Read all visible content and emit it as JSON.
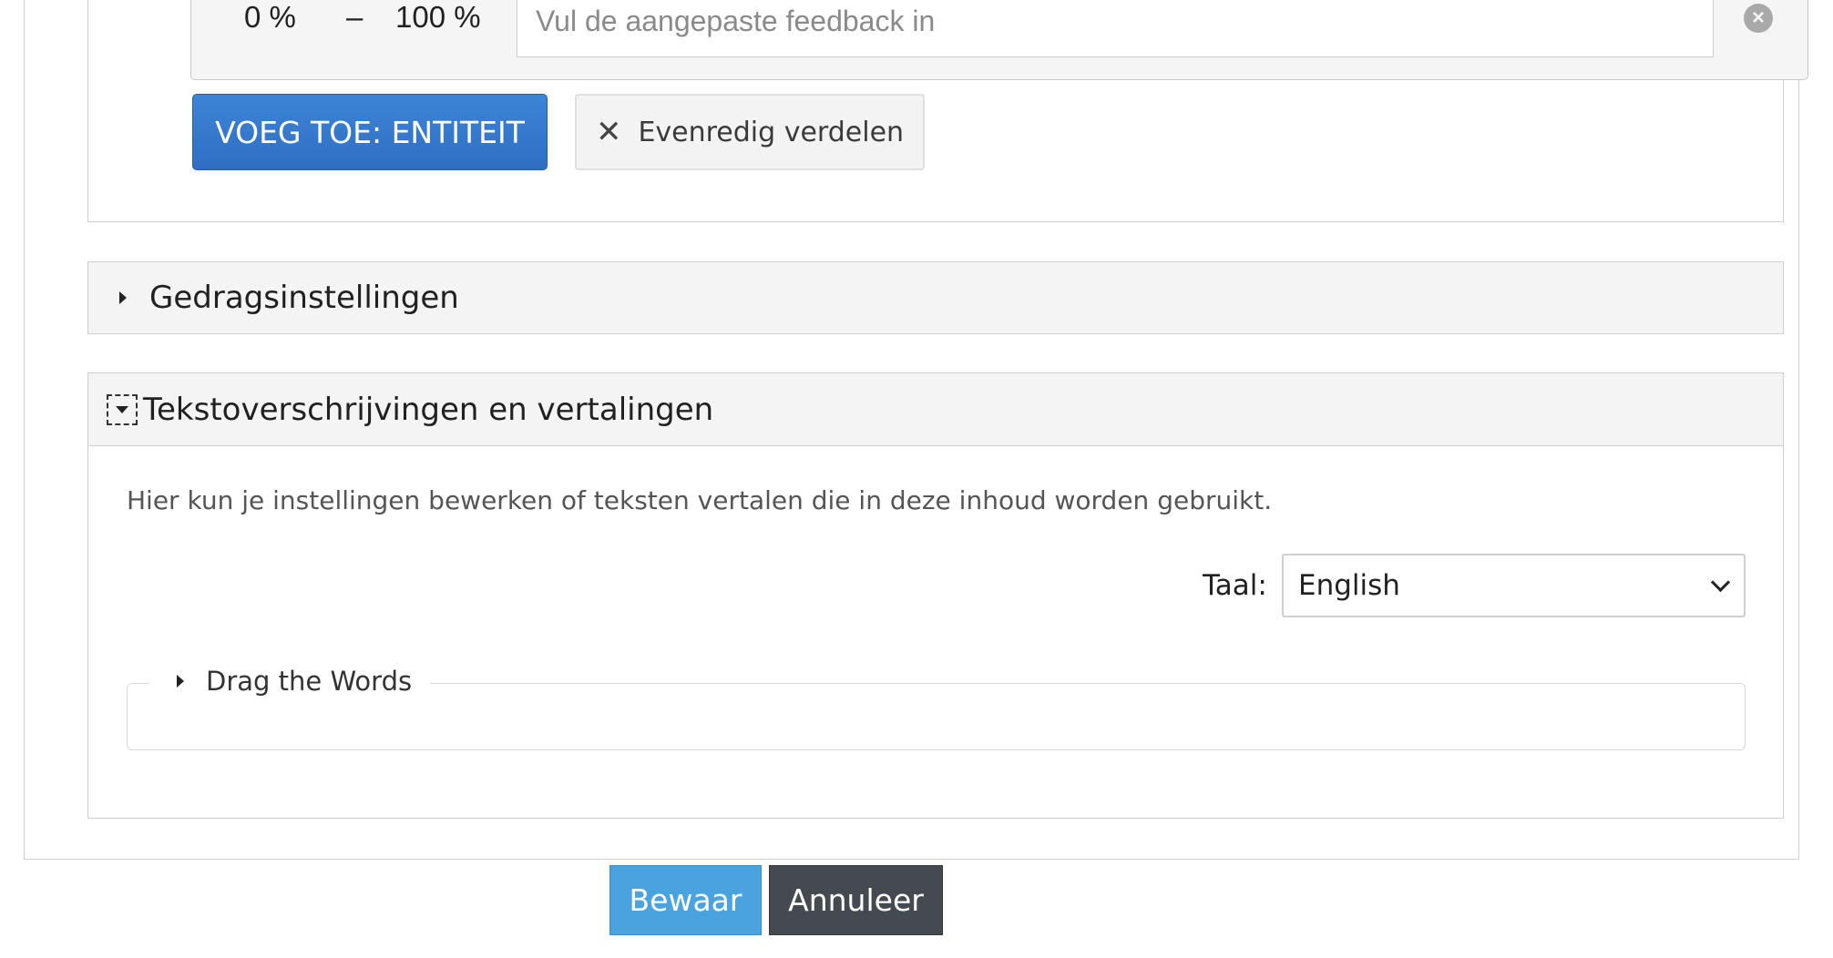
{
  "feedback_range": {
    "from": "0 %",
    "separator": "–",
    "to": "100 %",
    "input_placeholder": "Vul de aangepaste feedback in",
    "remove_icon": "×"
  },
  "buttons": {
    "add_entity": "VOEG TOE: ENTITEIT",
    "distribute_icon": "✕",
    "distribute": "Evenredig verdelen",
    "save": "Bewaar",
    "cancel": "Annuleer"
  },
  "groups": {
    "behaviour": "Gedragsinstellingen",
    "text_overrides": "Tekstoverschrijvingen en vertalingen"
  },
  "text_overrides": {
    "description": "Hier kun je instellingen bewerken of teksten vertalen die in deze inhoud worden gebruikt.",
    "language_label": "Taal:",
    "language_value": "English",
    "subgroup": "Drag the Words"
  },
  "colors": {
    "primary_blue": "#2f6fc3",
    "save_blue": "#4aa3df",
    "cancel_dark": "#454a50"
  }
}
